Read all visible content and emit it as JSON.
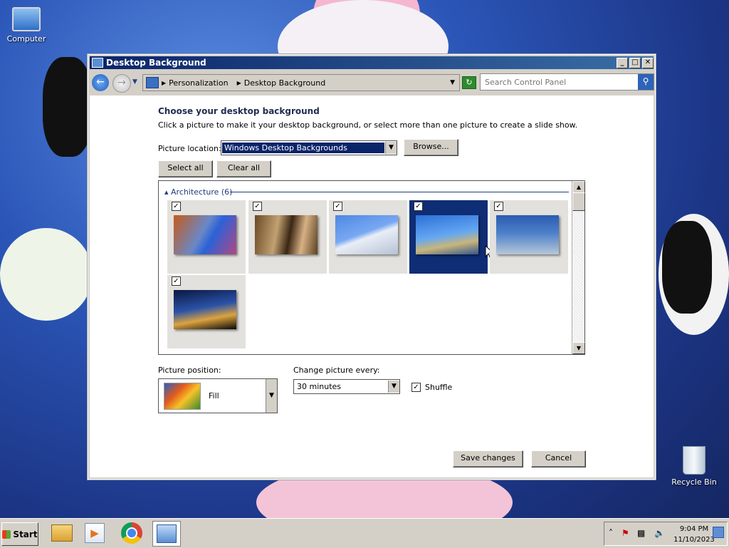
{
  "desktop": {
    "icons": [
      {
        "label": "Computer"
      },
      {
        "label": "Recycle Bin"
      }
    ]
  },
  "window": {
    "title": "Desktop Background",
    "controls": {
      "minimize": "_",
      "maximize": "□",
      "close": "✕"
    }
  },
  "navbar": {
    "breadcrumbs": [
      "Personalization",
      "Desktop Background"
    ],
    "search_placeholder": "Search Control Panel"
  },
  "main": {
    "heading": "Choose your desktop background",
    "description": "Click a picture to make it your desktop background, or select more than one picture to create a slide show.",
    "picture_location_label": "Picture location:",
    "picture_location_value": "Windows Desktop Backgrounds",
    "browse_label": "Browse...",
    "select_all_label": "Select all",
    "clear_all_label": "Clear all",
    "gallery": {
      "group_label": "Architecture (6)",
      "items": [
        {
          "checked": true,
          "selected": false
        },
        {
          "checked": true,
          "selected": false
        },
        {
          "checked": true,
          "selected": false
        },
        {
          "checked": true,
          "selected": true
        },
        {
          "checked": true,
          "selected": false
        },
        {
          "checked": true,
          "selected": false
        }
      ]
    },
    "picture_position_label": "Picture position:",
    "picture_position_value": "Fill",
    "change_picture_label": "Change picture every:",
    "change_picture_value": "30 minutes",
    "shuffle_label": "Shuffle",
    "shuffle_checked": true,
    "save_label": "Save changes",
    "cancel_label": "Cancel"
  },
  "taskbar": {
    "start_label": "Start",
    "apps": [
      "explorer",
      "media-center",
      "chrome",
      "control-panel"
    ],
    "clock_time": "9:04 PM",
    "clock_date": "11/10/2023"
  },
  "colors": {
    "selection": "#0f2d75",
    "titlebar": "#0a246a"
  }
}
